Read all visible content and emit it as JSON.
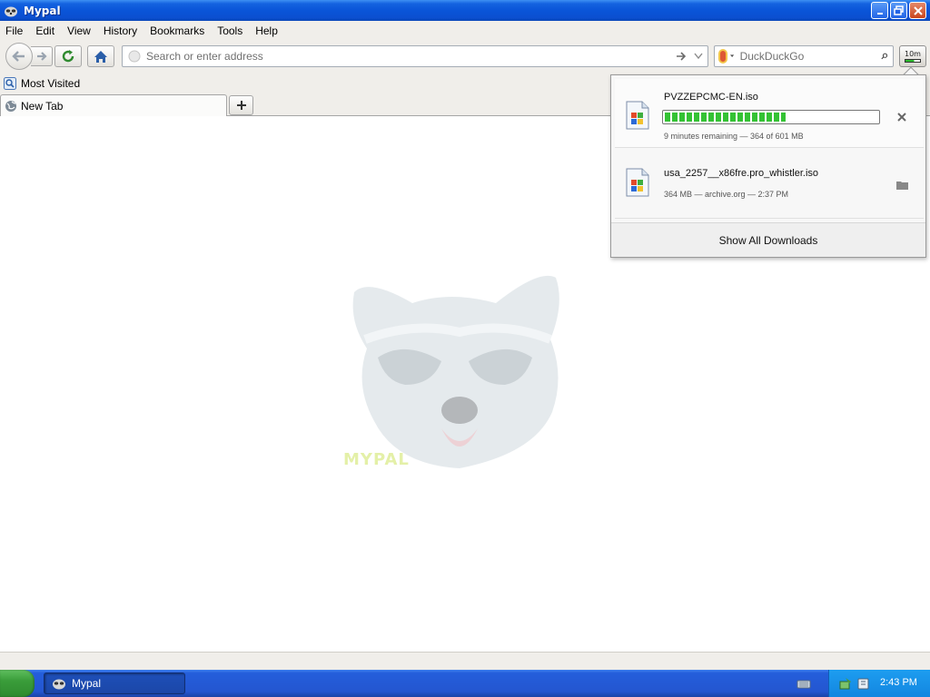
{
  "window": {
    "title": "Mypal"
  },
  "menu": {
    "items": [
      "File",
      "Edit",
      "View",
      "History",
      "Bookmarks",
      "Tools",
      "Help"
    ]
  },
  "navbar": {
    "address_placeholder": "Search or enter address",
    "search_placeholder": "DuckDuckGo",
    "downloads_time": "10m",
    "downloads_progress": 0.6
  },
  "bookmarks": {
    "items": [
      {
        "label": "Most Visited",
        "icon": "bookmark-folder-icon"
      }
    ]
  },
  "tabs": [
    {
      "label": "New Tab",
      "icon": "globe-icon"
    }
  ],
  "content": {
    "watermark": "MYPAL"
  },
  "downloads_panel": {
    "items": [
      {
        "name": "PVZZEPCMC-EN.iso",
        "status": "9 minutes remaining — 364 of 601 MB",
        "progress": 0.57,
        "action": "cancel-icon"
      },
      {
        "name": "usa_2257__x86fre.pro_whistler.iso",
        "status": "364 MB — archive.org — 2:37 PM",
        "action": "folder-icon"
      }
    ],
    "footer": "Show All Downloads"
  },
  "taskbar": {
    "task_label": "Mypal",
    "clock": "2:43 PM"
  },
  "colors": {
    "progress_green": "#34c234",
    "titlebar_blue": "#0a55d8",
    "taskbar_blue": "#245edb",
    "tray_blue": "#1386e0"
  }
}
